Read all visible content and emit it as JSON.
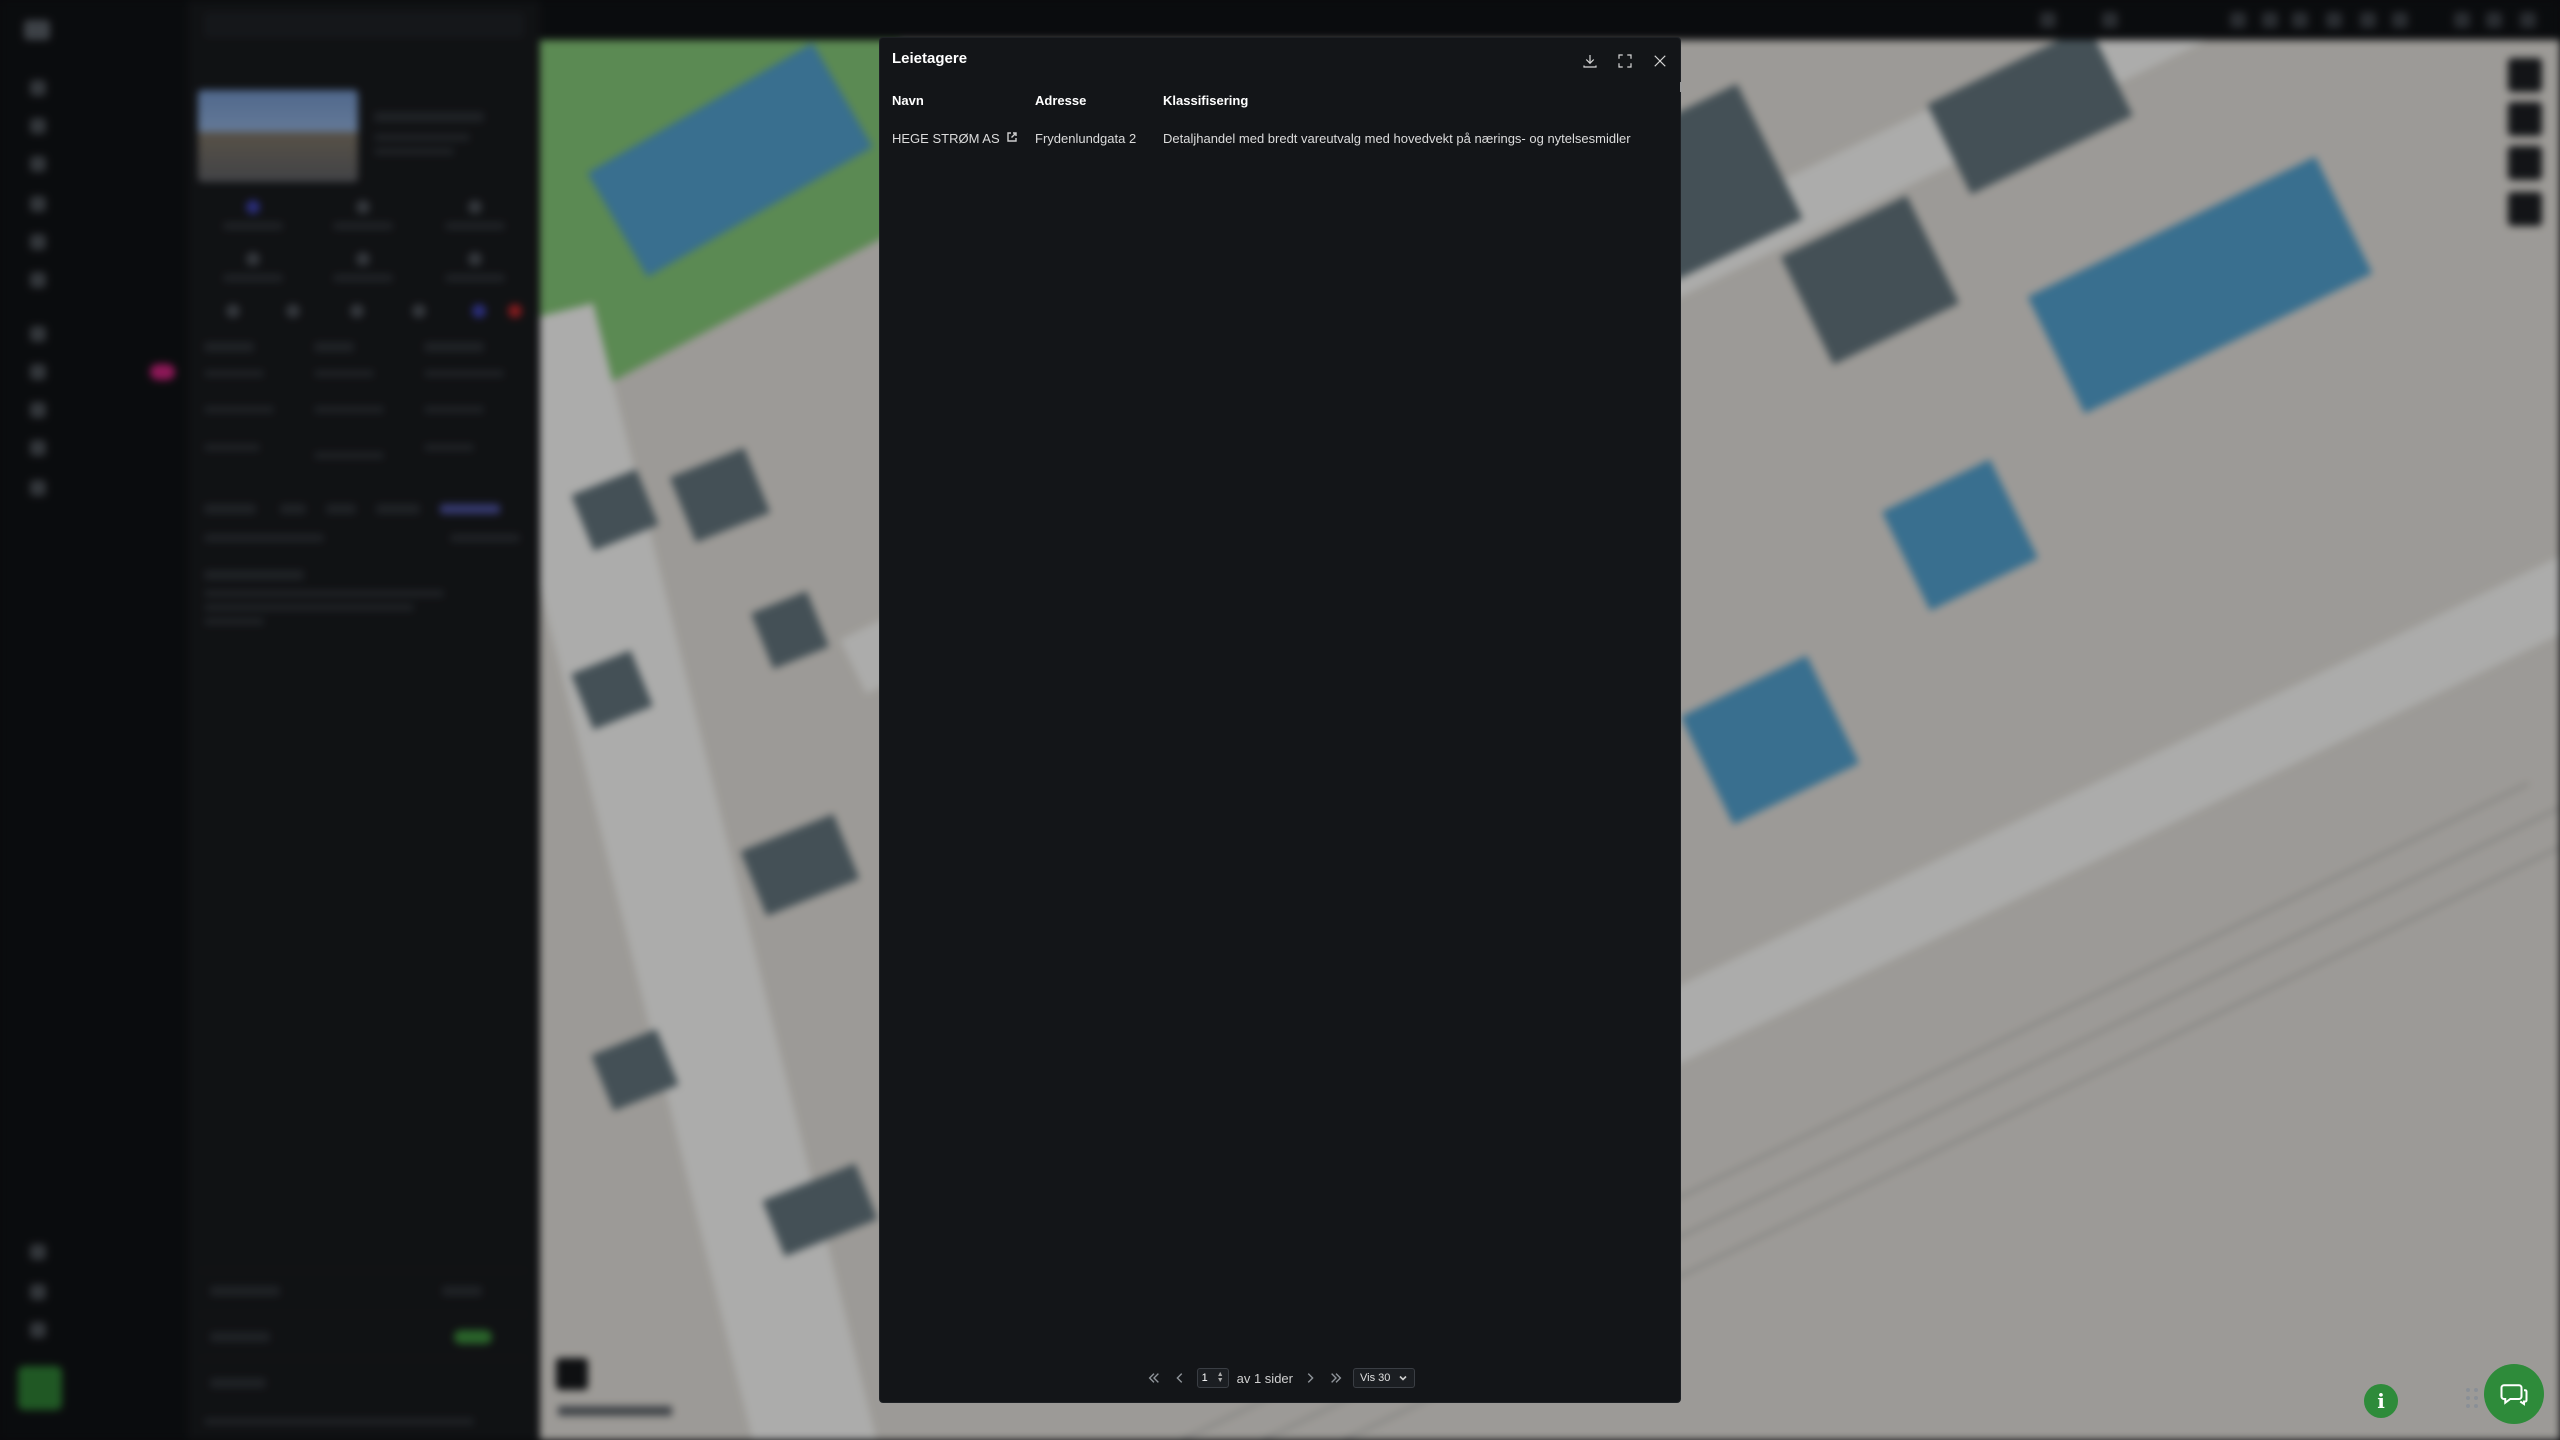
{
  "modal": {
    "title": "Leietagere",
    "columns": [
      "Navn",
      "Adresse",
      "Klassifisering"
    ],
    "rows": [
      {
        "navn": "HEGE STRØM AS",
        "adresse": "Frydenlundgata 2",
        "klassifisering": "Detaljhandel med bredt vareutvalg med hovedvekt på nærings- og nytelsesmidler"
      }
    ],
    "pagination": {
      "current_page": "1",
      "of_pages": "av 1 sider",
      "per_page": "Vis 30"
    }
  },
  "icons": {
    "download": "download-icon",
    "fullscreen": "fullscreen-icon",
    "close": "close-icon",
    "external_link": "external-link-icon",
    "info": "i",
    "chat": "chat-icon"
  },
  "colors": {
    "modal_bg": "#131518",
    "accent_green": "#2e8b3a",
    "badge_pink": "#c4227a"
  }
}
